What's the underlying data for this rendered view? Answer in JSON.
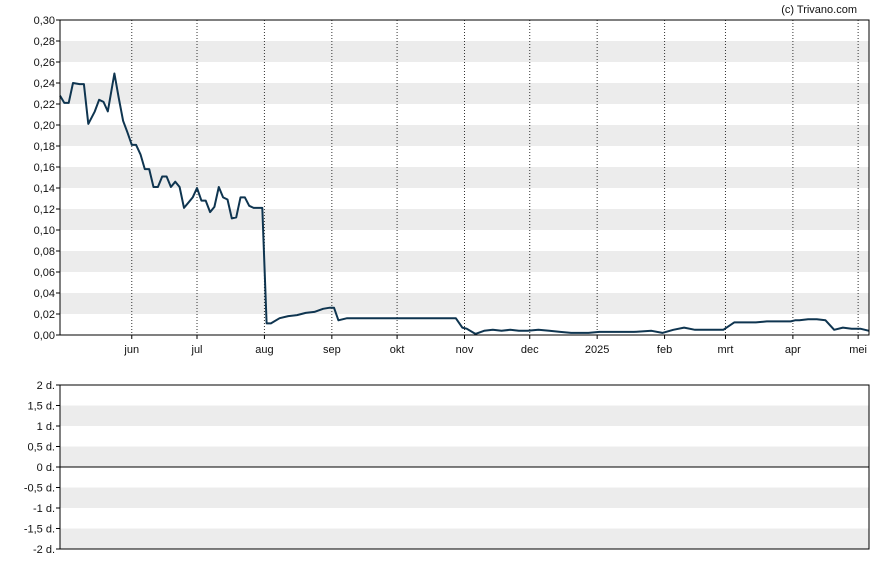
{
  "watermark": "(c) Trivano.com",
  "colors": {
    "line": "#0f3550",
    "band": "#ececec",
    "axis": "#000000",
    "month_grid": "#333333"
  },
  "chart_data": [
    {
      "type": "line",
      "title": "",
      "xlabel": "",
      "ylabel": "",
      "grid": true,
      "ylim": [
        0,
        0.3
      ],
      "yticks": [
        "0,30",
        "0,28",
        "0,26",
        "0,24",
        "0,22",
        "0,20",
        "0,18",
        "0,16",
        "0,14",
        "0,12",
        "0,10",
        "0,08",
        "0,06",
        "0,04",
        "0,02",
        "0,00"
      ],
      "xlim": [
        "2024-04-29",
        "2025-05-06"
      ],
      "month_labels": [
        {
          "label": "jun",
          "date": "2024-06-01"
        },
        {
          "label": "jul",
          "date": "2024-07-01"
        },
        {
          "label": "aug",
          "date": "2024-08-01"
        },
        {
          "label": "sep",
          "date": "2024-09-01"
        },
        {
          "label": "okt",
          "date": "2024-10-01"
        },
        {
          "label": "nov",
          "date": "2024-11-01"
        },
        {
          "label": "dec",
          "date": "2024-12-01"
        },
        {
          "label": "2025",
          "date": "2025-01-01"
        },
        {
          "label": "feb",
          "date": "2025-02-01"
        },
        {
          "label": "mrt",
          "date": "2025-03-01"
        },
        {
          "label": "apr",
          "date": "2025-04-01"
        },
        {
          "label": "mei",
          "date": "2025-05-01"
        }
      ],
      "series": [
        {
          "x": [
            "2024-04-29",
            "2024-05-01",
            "2024-05-03",
            "2024-05-05",
            "2024-05-08",
            "2024-05-10",
            "2024-05-12",
            "2024-05-15",
            "2024-05-17",
            "2024-05-19",
            "2024-05-21",
            "2024-05-24",
            "2024-05-26",
            "2024-05-28",
            "2024-05-30",
            "2024-06-01",
            "2024-06-03",
            "2024-06-05",
            "2024-06-07",
            "2024-06-09",
            "2024-06-11",
            "2024-06-13",
            "2024-06-15",
            "2024-06-17",
            "2024-06-19",
            "2024-06-21",
            "2024-06-23",
            "2024-06-25",
            "2024-06-27",
            "2024-06-29",
            "2024-07-01",
            "2024-07-03",
            "2024-07-05",
            "2024-07-07",
            "2024-07-09",
            "2024-07-11",
            "2024-07-13",
            "2024-07-15",
            "2024-07-17",
            "2024-07-19",
            "2024-07-21",
            "2024-07-23",
            "2024-07-25",
            "2024-07-27",
            "2024-07-29",
            "2024-07-31",
            "2024-08-02",
            "2024-08-04",
            "2024-08-08",
            "2024-08-12",
            "2024-08-16",
            "2024-08-20",
            "2024-08-24",
            "2024-08-28",
            "2024-08-31",
            "2024-09-02",
            "2024-09-04",
            "2024-09-08",
            "2024-09-15",
            "2024-09-22",
            "2024-10-01",
            "2024-10-15",
            "2024-10-28",
            "2024-10-31",
            "2024-11-02",
            "2024-11-06",
            "2024-11-10",
            "2024-11-14",
            "2024-11-18",
            "2024-11-22",
            "2024-11-26",
            "2024-11-30",
            "2024-12-05",
            "2024-12-10",
            "2024-12-15",
            "2024-12-20",
            "2024-12-28",
            "2025-01-02",
            "2025-01-10",
            "2025-01-18",
            "2025-01-26",
            "2025-01-31",
            "2025-02-05",
            "2025-02-10",
            "2025-02-15",
            "2025-02-20",
            "2025-02-28",
            "2025-03-05",
            "2025-03-10",
            "2025-03-15",
            "2025-03-20",
            "2025-03-26",
            "2025-03-31",
            "2025-04-02",
            "2025-04-04",
            "2025-04-08",
            "2025-04-12",
            "2025-04-16",
            "2025-04-20",
            "2025-04-24",
            "2025-04-28",
            "2025-05-02",
            "2025-05-06"
          ],
          "y": [
            0.228,
            0.221,
            0.221,
            0.24,
            0.239,
            0.239,
            0.201,
            0.213,
            0.224,
            0.222,
            0.213,
            0.249,
            0.226,
            0.204,
            0.193,
            0.181,
            0.181,
            0.172,
            0.158,
            0.158,
            0.141,
            0.141,
            0.151,
            0.151,
            0.141,
            0.146,
            0.141,
            0.121,
            0.126,
            0.131,
            0.14,
            0.128,
            0.128,
            0.117,
            0.122,
            0.141,
            0.131,
            0.129,
            0.111,
            0.112,
            0.131,
            0.131,
            0.123,
            0.121,
            0.121,
            0.121,
            0.011,
            0.011,
            0.016,
            0.018,
            0.019,
            0.021,
            0.022,
            0.025,
            0.026,
            0.026,
            0.014,
            0.016,
            0.016,
            0.016,
            0.016,
            0.016,
            0.016,
            0.007,
            0.006,
            0.001,
            0.004,
            0.005,
            0.004,
            0.005,
            0.004,
            0.004,
            0.005,
            0.004,
            0.003,
            0.002,
            0.002,
            0.003,
            0.003,
            0.003,
            0.004,
            0.002,
            0.005,
            0.007,
            0.005,
            0.005,
            0.005,
            0.012,
            0.012,
            0.012,
            0.013,
            0.013,
            0.013,
            0.014,
            0.014,
            0.015,
            0.015,
            0.014,
            0.005,
            0.007,
            0.006,
            0.006,
            0.004
          ]
        }
      ]
    },
    {
      "type": "bar",
      "title": "",
      "xlabel": "",
      "ylabel": "",
      "grid": true,
      "ylim": [
        -2,
        2
      ],
      "yticks": [
        "2 d.",
        "1,5 d.",
        "1 d.",
        "0,5 d.",
        "0 d.",
        "-0,5 d.",
        "-1 d.",
        "-1,5 d.",
        "-2 d."
      ],
      "values": []
    }
  ]
}
